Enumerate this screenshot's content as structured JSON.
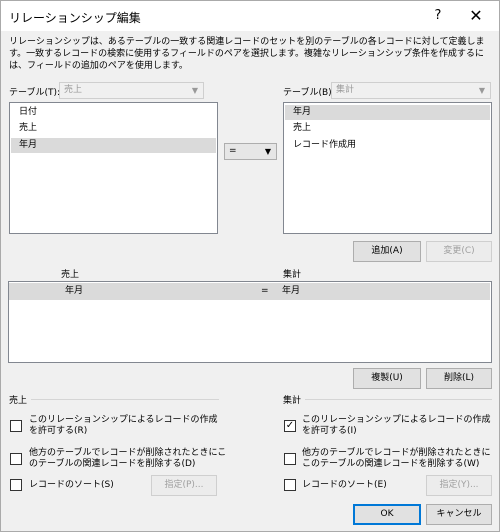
{
  "window": {
    "title": "リレーションシップ編集",
    "help": "?",
    "close": "✕"
  },
  "description": "リレーションシップは、あるテーブルの一致する関連レコードのセットを別のテーブルの各レコードに対して定義します。一致するレコードの検索に使用するフィールドのペアを選択します。複雑なリレーションシップ条件を作成するには、フィールドの追加のペアを使用します。",
  "left_table": {
    "label": "テーブル(T):",
    "value": "売上",
    "fields": [
      "日付",
      "売上",
      "年月"
    ],
    "selected_index": 2
  },
  "operator": {
    "value": "="
  },
  "right_table": {
    "label": "テーブル(B):",
    "value": "集計",
    "fields": [
      "年月",
      "売上",
      "レコード作成用"
    ],
    "selected_index": 0
  },
  "buttons": {
    "add": "追加(A)",
    "change": "変更(C)",
    "duplicate": "複製(U)",
    "delete": "削除(L)",
    "ok": "OK",
    "cancel": "キャンセル",
    "specify_left": "指定(P)...",
    "specify_right": "指定(Y)..."
  },
  "relations": {
    "left_header": "売上",
    "right_header": "集計",
    "rows": [
      {
        "left": "年月",
        "op": "=",
        "right": "年月"
      }
    ]
  },
  "left_group": {
    "title": "売上",
    "allow_create": {
      "label": "このリレーションシップによるレコードの作成を許可する(R)",
      "checked": false
    },
    "cascade_delete": {
      "label": "他方のテーブルでレコードが削除されたときにこのテーブルの関連レコードを削除する(D)",
      "checked": false
    },
    "sort": {
      "label": "レコードのソート(S)",
      "checked": false
    }
  },
  "right_group": {
    "title": "集計",
    "allow_create": {
      "label": "このリレーションシップによるレコードの作成を許可する(I)",
      "checked": true
    },
    "cascade_delete": {
      "label": "他方のテーブルでレコードが削除されたときにこのテーブルの関連レコードを削除する(W)",
      "checked": false
    },
    "sort": {
      "label": "レコードのソート(E)",
      "checked": false
    }
  },
  "icons": {
    "dropdown": "chevron-down-icon",
    "check": "checkmark-icon"
  }
}
